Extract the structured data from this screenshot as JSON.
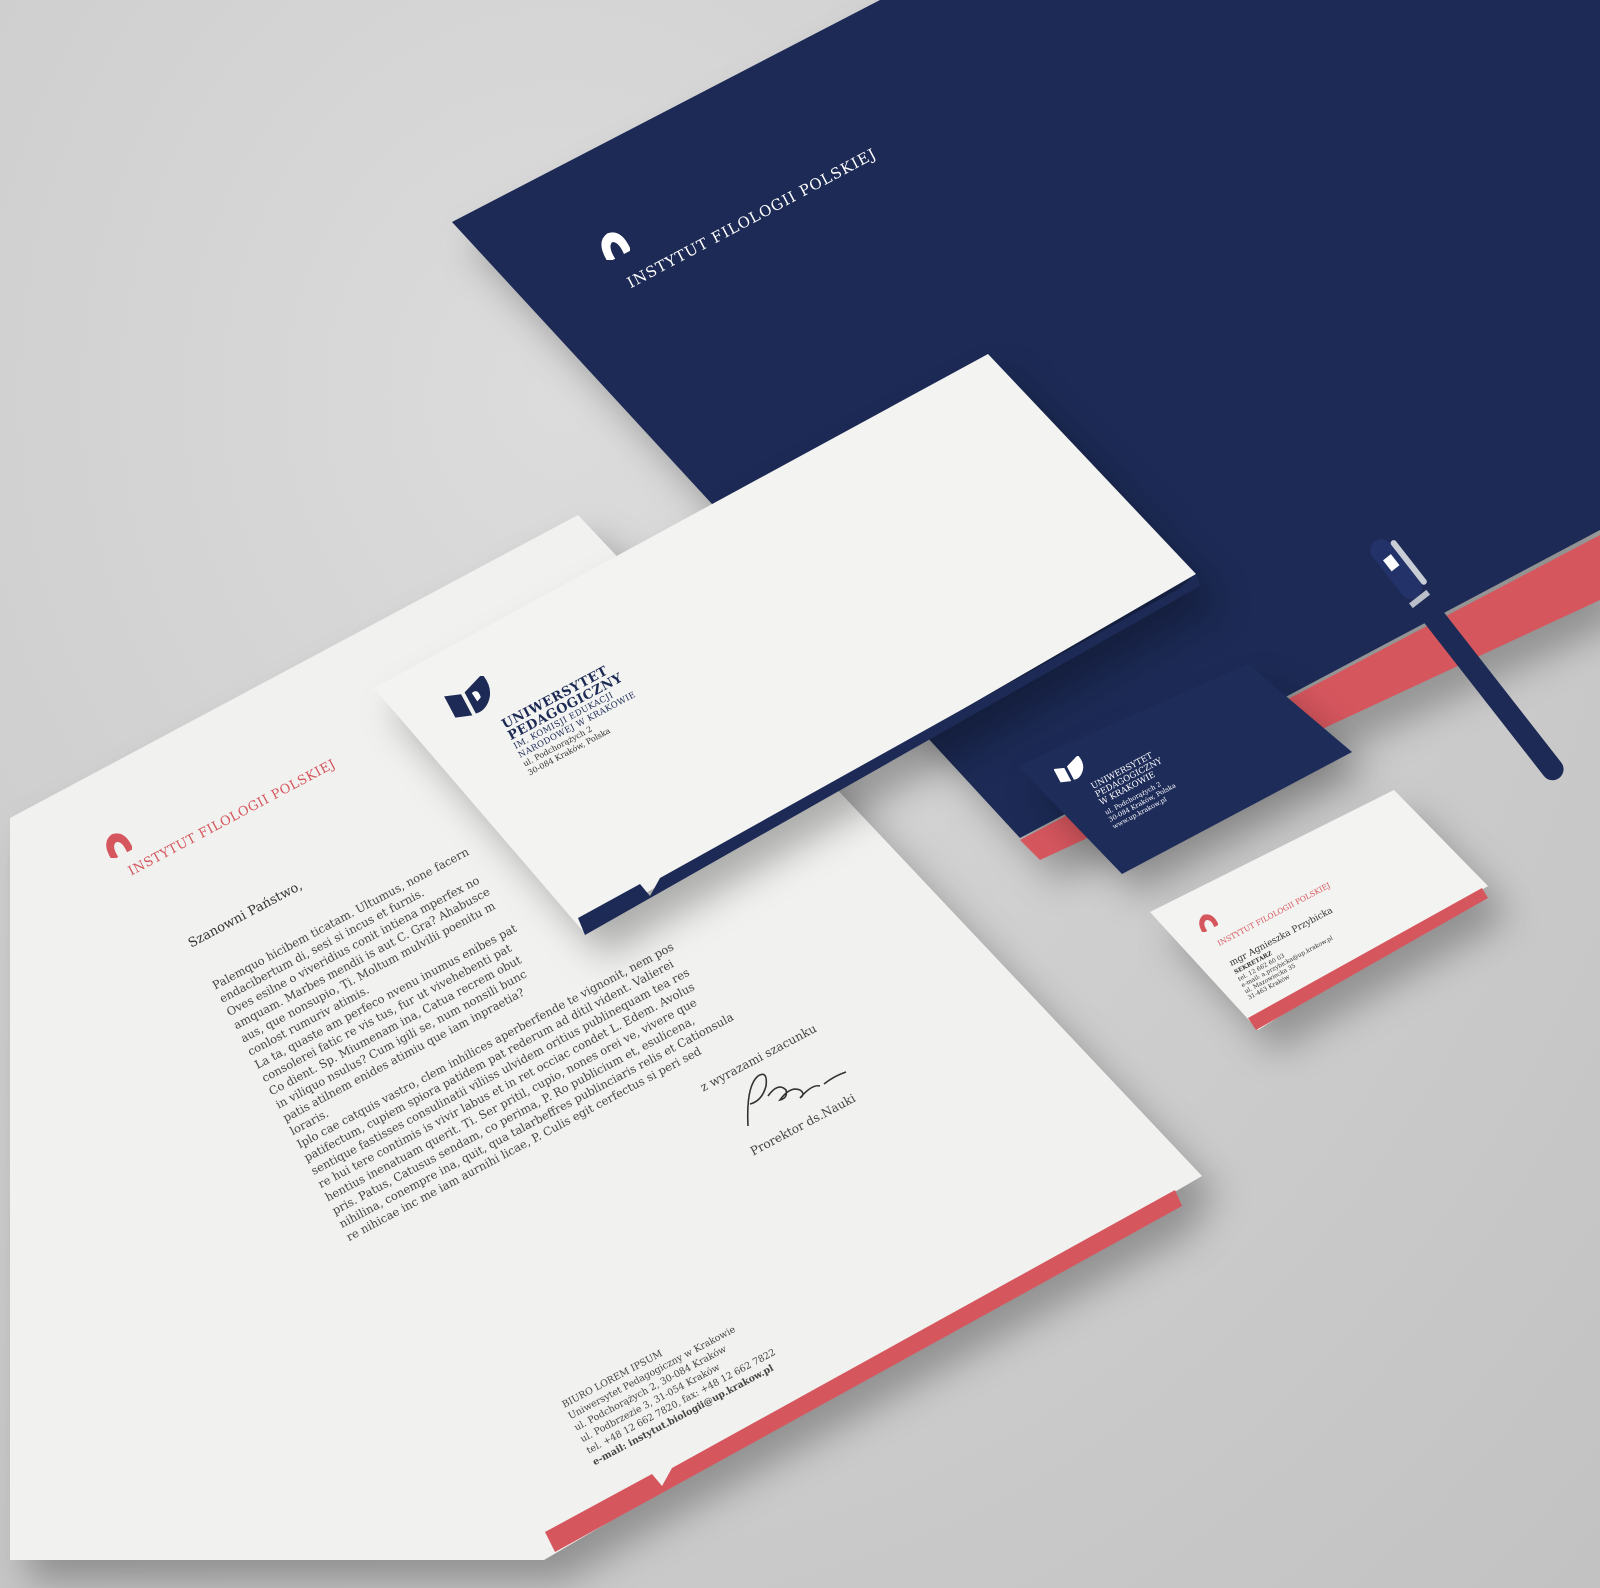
{
  "folder": {
    "title": "INSTYTUT FILOLOGII POLSKIEJ"
  },
  "envelope": {
    "university_line1": "UNIWERSYTET",
    "university_line2": "PEDAGOGICZNY",
    "sub1": "IM. KOMISJI EDUKACJI",
    "sub2": "NARODOWEJ W KRAKOWIE",
    "address1": "ul. Podchorążych 2",
    "address2": "30-084 Kraków, Polska"
  },
  "business_card_navy": {
    "line1": "UNIWERSYTET",
    "line2": "PEDAGOGICZNY",
    "line3": "W KRAKOWIE",
    "address1": "ul. Podchorążych 2",
    "address2": "30-084 Kraków, Polska",
    "web": "www.up.krakow.pl"
  },
  "business_card_white": {
    "header": "INSTYTUT FILOLOGII POLSKIEJ",
    "name": "mgr Agnieszka Przybicka",
    "role": "SEKRETARZ",
    "phone": "tel. 12 662 60 03",
    "email": "e-mail: a.przybicka@up.krakow.pl",
    "street": "ul. Mazowiecka 35",
    "city": "31-463 Kraków"
  },
  "letterhead": {
    "header": "INSTYTUT FILOLOGII POLSKIEJ",
    "greeting": "Szanowni Państwo,",
    "body_lines": [
      "Palemquo hicibem ticatam. Ultumus, none facern",
      "endacibertum di, sesi si incus et furnis.",
      "Oves esilne o viveridius conit intiena mperfex no",
      "amquam. Marbes mendii is aut C. Gra? Ahabusce",
      "aus, que nonsupio, Ti. Moltum mulvilii poenitu m",
      "conlost rumuriv atimis.",
      "La ta, quaste am perfeco nvenu inumus enibes pat",
      "consolerei fatic re vis tus, fur ut vivehebenti pat",
      "Co dient. Sp. Miumenam ina, Catua recrem obut",
      "in viliquo nsulus? Cum igili se, num nonsili bunc",
      "patis atilnem enides atimiu que iam inpraetia?",
      "loraris.",
      "Iplo cae catquis vastro, clem inhilices aperberfende te vignonit, nem pos",
      "patifectum, cupiem spiora patidem pat rederum ad ditil vident. Valierei",
      "sentique fastisses consulinatii viliiss ulvidem oritius publinequam tea res",
      "re hui tere contimis is vivir labus et in ret occiac condet L. Edem. Avolus",
      "hentius inenatuam querit. Ti. Ser pritil, cupio, nones orei ve, vivere que",
      "pris. Patus, Catusus sendam, co perima, P. Ro publicium et, esulicena,",
      "nihilina, conempre ina, quit, qua talarbeffres publinciaris relis et Cationsula",
      "re nihicae inc me iam aurnihi licae, P. Culis egit cerfectus si peri sed"
    ],
    "closing": "z wyrazami szacunku",
    "signer_title": "Prorektor ds.Nauki",
    "footer_lines": [
      "BIURO LOREM IPSUM",
      "Uniwersytet Pedagogiczny w Krakowie",
      "ul. Podchorążych 2, 30-084 Kraków",
      "ul. Podbrzezie 3, 31-054 Kraków",
      "tel. +48 12 662 7820, fax: +48 12 662 7822",
      "e-mail: instytut.biologii@up.krakow.pl"
    ]
  },
  "colors": {
    "navy": "#1c2a55",
    "red": "#d6565e",
    "paper": "#efefed",
    "background": "#cfcfcf"
  }
}
